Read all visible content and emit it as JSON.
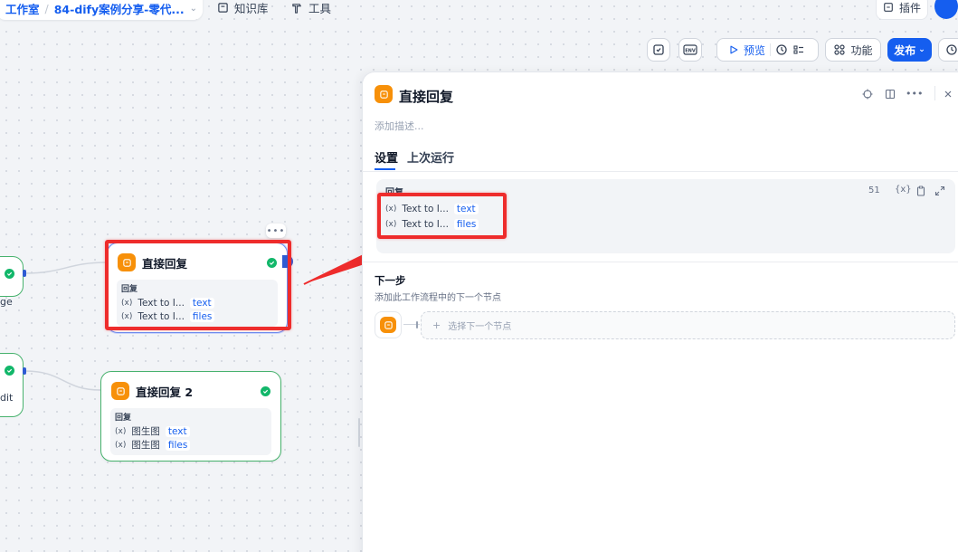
{
  "breadcrumb": {
    "home": "工作室",
    "app": "84-dify案例分享-零代..."
  },
  "topnav": {
    "knowledge": "知识库",
    "tools": "工具",
    "plugins": "插件"
  },
  "toolbar": {
    "env_label": "ENV",
    "preview": "预览",
    "features": "功能",
    "publish": "发布"
  },
  "canvas": {
    "partial_top_label": "ge",
    "partial_bottom_label": "dit",
    "node1": {
      "title": "直接回复",
      "section_label": "回复",
      "rows": [
        {
          "var": "Text to I...",
          "tag": "text"
        },
        {
          "var": "Text to I...",
          "tag": "files"
        }
      ]
    },
    "node2": {
      "title": "直接回复 2",
      "section_label": "回复",
      "rows": [
        {
          "var": "图生图",
          "tag": "text"
        },
        {
          "var": "图生图",
          "tag": "files"
        }
      ]
    }
  },
  "panel": {
    "title": "直接回复",
    "description_placeholder": "添加描述...",
    "tabs": [
      "设置",
      "上次运行"
    ],
    "reply": {
      "label": "回复",
      "char_count": "51",
      "var_button": "{x}",
      "rows": [
        {
          "var": "Text to I...",
          "tag": "text"
        },
        {
          "var": "Text to I...",
          "tag": "files"
        }
      ]
    },
    "next_step": {
      "title": "下一步",
      "description": "添加此工作流程中的下一个节点",
      "select_placeholder": "选择下一个节点"
    }
  },
  "colors": {
    "accent": "#155eef",
    "success": "#12b76a",
    "node_icon": "#f79009",
    "annotation": "#ee2c2c"
  }
}
